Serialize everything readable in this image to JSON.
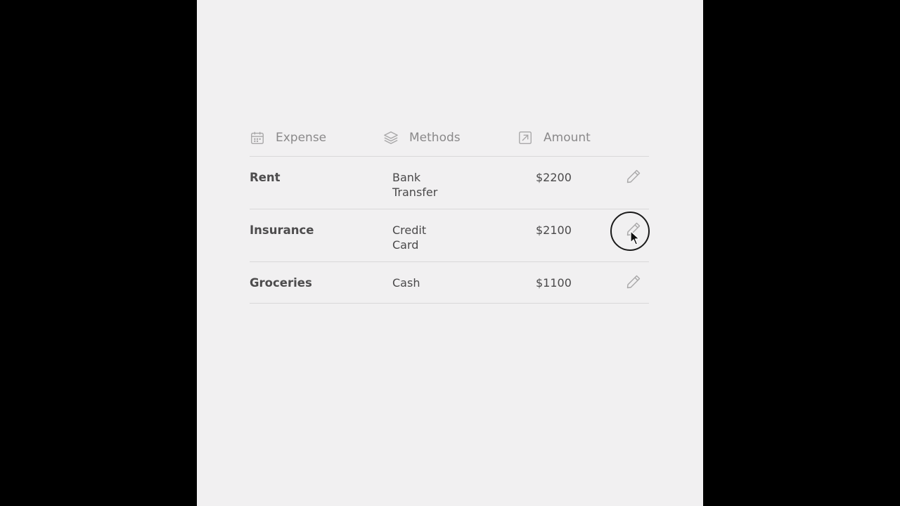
{
  "table": {
    "headers": [
      {
        "label": "Expense",
        "icon": "calendar-icon"
      },
      {
        "label": "Methods",
        "icon": "layers-icon"
      },
      {
        "label": "Amount",
        "icon": "arrow-up-right-box-icon"
      }
    ],
    "rows": [
      {
        "name": "Rent",
        "method_line1": "Bank",
        "method_line2": "Transfer",
        "amount": "$2200",
        "action_icon": "pencil-icon"
      },
      {
        "name": "Insurance",
        "method_line1": "Credit",
        "method_line2": "Card",
        "amount": "$2100",
        "action_icon": "pencil-icon"
      },
      {
        "name": "Groceries",
        "method_line1": "Cash",
        "method_line2": "",
        "amount": "$1100",
        "action_icon": "pencil-icon"
      }
    ]
  },
  "colors": {
    "page_background": "#000000",
    "panel_background": "#f1f0f1",
    "header_text": "#8a898a",
    "row_text": "#4a494a",
    "divider": "#d9d8d9",
    "icon_stroke": "#a8a7a8"
  }
}
